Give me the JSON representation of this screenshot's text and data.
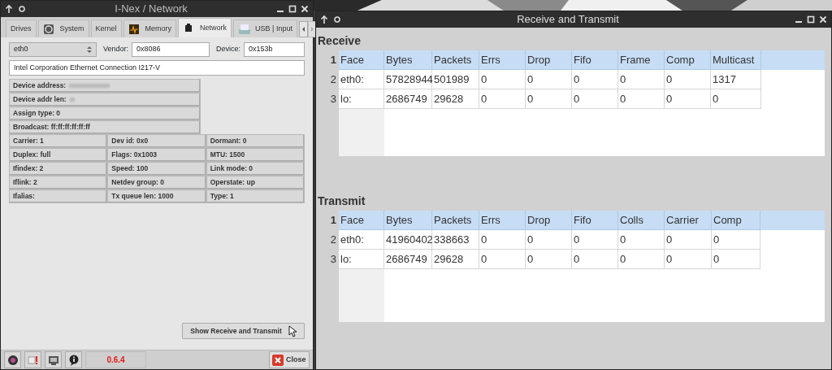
{
  "info_window": {
    "title": "I-Nex / Network",
    "tabs": [
      {
        "label": "Drives",
        "selected": false
      },
      {
        "label": "System",
        "selected": false
      },
      {
        "label": "Kernel",
        "selected": false
      },
      {
        "label": "Memory",
        "selected": false
      },
      {
        "label": "Network",
        "selected": true
      },
      {
        "label": "USB | Input",
        "selected": false
      }
    ],
    "interface_select": {
      "value": "eth0"
    },
    "vendor": {
      "label": "Vendor:",
      "value": "0x8086"
    },
    "device": {
      "label": "Device:",
      "value": "0x153b"
    },
    "description": {
      "value": "Intel Corporation Ethernet Connection I217-V"
    },
    "details": [
      {
        "text": "Device address:",
        "redacted": true
      },
      {
        "text": "Device addr len:",
        "redacted": true
      },
      {
        "text": "Assign type: 0",
        "redacted": false
      },
      {
        "text": "Broadcast: ff:ff:ff:ff:ff:ff",
        "redacted": false
      }
    ],
    "properties": [
      "Carrier: 1",
      "Dev id: 0x0",
      "Dormant: 0",
      "Duplex: full",
      "Flags: 0x1003",
      "MTU: 1500",
      "Ifindex: 2",
      "Speed: 100",
      "Link mode: 0",
      "Iflink: 2",
      "Netdev group: 0",
      "Operstate: up",
      "Ifalias:",
      "Tx queue len: 1000",
      "Type: 1"
    ],
    "show_button": "Show Receive and Transmit",
    "version": "0.6.4",
    "close_button": "Close"
  },
  "stats_window": {
    "title": "Receive and Transmit",
    "sections": [
      {
        "heading": "Receive",
        "row_labels": [
          "1",
          "2",
          "3"
        ],
        "columns": [
          "Face",
          "Bytes",
          "Packets",
          "Errs",
          "Drop",
          "Fifo",
          "Frame",
          "Comp",
          "Multicast"
        ],
        "rows": [
          [
            "eth0:",
            "57828944",
            "501989",
            "0",
            "0",
            "0",
            "0",
            "0",
            "1317"
          ],
          [
            "lo:",
            "2686749",
            "29628",
            "0",
            "0",
            "0",
            "0",
            "0",
            "0"
          ]
        ]
      },
      {
        "heading": "Transmit",
        "row_labels": [
          "1",
          "2",
          "3"
        ],
        "columns": [
          "Face",
          "Bytes",
          "Packets",
          "Errs",
          "Drop",
          "Fifo",
          "Colls",
          "Carrier",
          "Comp"
        ],
        "rows": [
          [
            "eth0:",
            "41960402",
            "338663",
            "0",
            "0",
            "0",
            "0",
            "0",
            "0"
          ],
          [
            "lo:",
            "2686749",
            "29628",
            "0",
            "0",
            "0",
            "0",
            "0",
            "0"
          ]
        ]
      }
    ]
  }
}
